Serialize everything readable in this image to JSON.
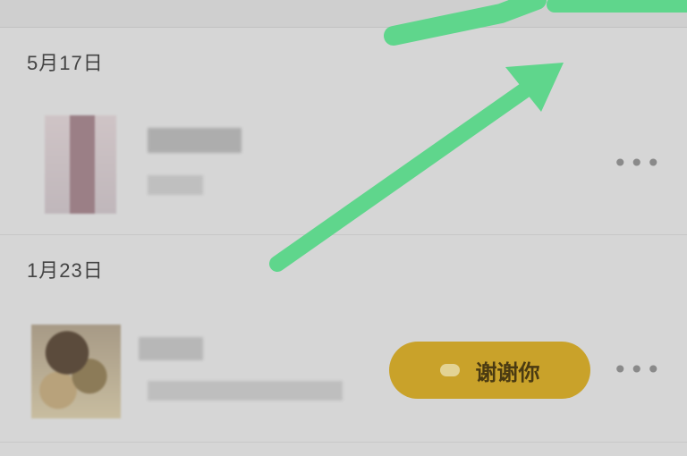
{
  "sections": [
    {
      "date": "5月17日",
      "more_label": "•••"
    },
    {
      "date": "1月23日",
      "action_label": "谢谢你",
      "more_label": "•••"
    }
  ],
  "colors": {
    "background": "#d6d6d6",
    "accent": "#c9a22a",
    "annotation_arrow": "#5fd68c"
  },
  "icons": [
    "heart-icon",
    "more-icon"
  ]
}
